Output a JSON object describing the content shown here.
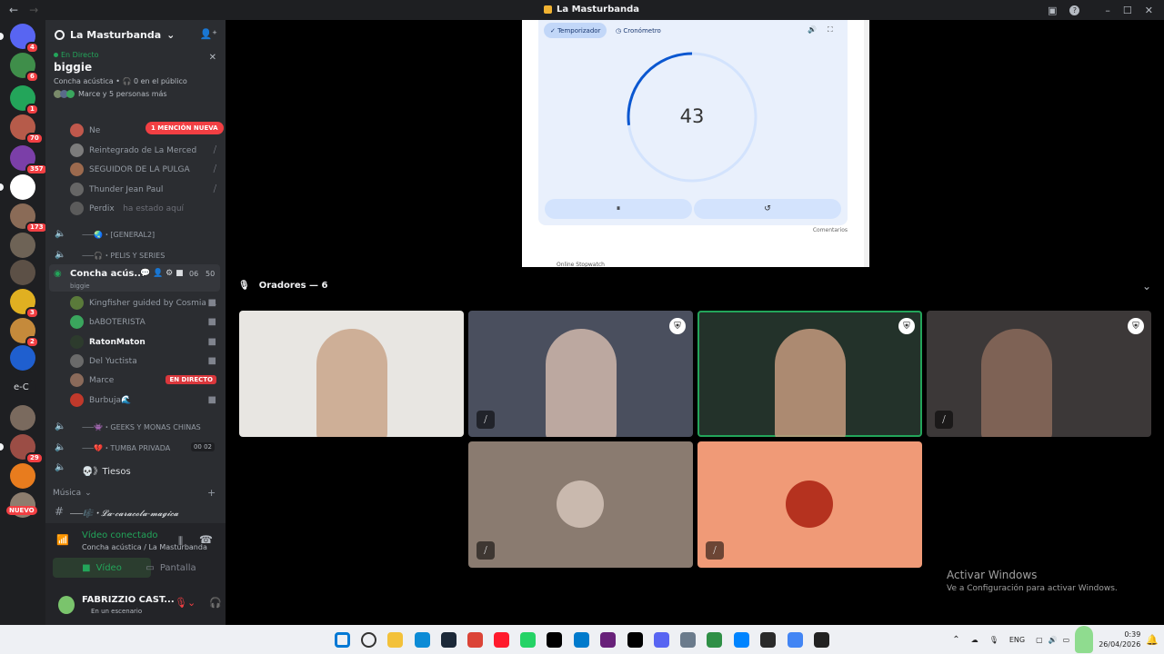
{
  "window": {
    "title": "La Masturbanda"
  },
  "guilds": [
    {
      "badge": "4",
      "color": "#5865f2"
    },
    {
      "badge": "6",
      "color": "#3f8e4a"
    },
    {
      "badge": "1",
      "color": "#23a55a"
    },
    {
      "badge": "70",
      "color": "#b65b4a"
    },
    {
      "badge": "357",
      "color": "#7b3fa8"
    },
    {
      "badge": "",
      "color": "#ffffff"
    },
    {
      "badge": "173",
      "color": "#8a6b57"
    },
    {
      "badge": "",
      "color": "#6e6356"
    },
    {
      "badge": "",
      "color": "#5c5046"
    },
    {
      "badge": "3",
      "color": "#e0b021"
    },
    {
      "badge": "2",
      "color": "#c58a3b"
    },
    {
      "badge": "",
      "color": "#1f5fcf"
    },
    {
      "badge": "",
      "color": "#1e1f22"
    },
    {
      "badge": "",
      "color": "#7a6a5e"
    },
    {
      "badge": "29",
      "color": "#9b4d45"
    },
    {
      "badge": "",
      "color": "#e87c1e"
    },
    {
      "badge": "",
      "color": "#8d7d6e"
    }
  ],
  "guild_text_item": "e-C",
  "guild_new_label": "NUEVO",
  "server": {
    "name": "La Masturbanda"
  },
  "stage": {
    "live_label": "En Directo",
    "name": "biggie",
    "sub": "Concha acústica • 🎧 0 en el público",
    "people": "Marce y 5 personas más"
  },
  "mention_label": "1 MENCIÓN NUEVA",
  "members_top": [
    {
      "name": "Ne",
      "color": "#c0584c"
    },
    {
      "name": "Reintegrado de La Merced",
      "color": "#7c7c7c"
    },
    {
      "name": "SEGUIDOR DE LA PULGA",
      "color": "#9c6a4e"
    },
    {
      "name": "Thunder Jean Paul",
      "color": "#666666"
    },
    {
      "name": "Perdix",
      "extra": "ha estado aquí",
      "color": "#5b5b5b"
    }
  ],
  "voice_channels_top": [
    {
      "name": "⸺🌏・[GENERAL2]"
    },
    {
      "name": "⸺🎧・PELIS Y SERIES"
    }
  ],
  "active_channel": {
    "name": "Concha acús...",
    "count_a": "06",
    "count_b": "50",
    "sub": "biggie"
  },
  "channel_members": [
    {
      "name": "Kingfisher guided by Cosmia ...",
      "color": "#5a7a3a",
      "live": false
    },
    {
      "name": "bABOTERISTA",
      "color": "#3aa55d",
      "live": false
    },
    {
      "name": "RatonMaton",
      "color": "#2d3b2d",
      "live": false
    },
    {
      "name": "Del Yuctista",
      "color": "#6a6a6a",
      "live": false
    },
    {
      "name": "Marce",
      "color": "#8a6a5a",
      "live": true
    },
    {
      "name": "Burbuja🌊",
      "color": "#c0392b",
      "live": false
    }
  ],
  "live_badge": "EN DIRECTO",
  "voice_channels_bottom": [
    {
      "name": "⸺👾・GEEKS Y MONAS CHINAS",
      "counts": ""
    },
    {
      "name": "⸺💔・TUMBA PRIVADA",
      "counts": "00 02"
    },
    {
      "name": "💀》Tiesos",
      "counts": ""
    }
  ],
  "category": {
    "name": "Música"
  },
  "text_channel": {
    "name": "⸺🎼・𝓛𝓪-𝓬𝓪𝓻𝓪𝓬𝓸𝓵𝓪-𝓶𝓪𝓰𝓲𝓬𝓪"
  },
  "voice_panel": {
    "status": "Vídeo conectado",
    "location": "Concha acústica / La Masturbanda",
    "video_label": "Vídeo",
    "screen_label": "Pantalla"
  },
  "user": {
    "name": "FABRIZZIO CAST...",
    "status": "En un escenario"
  },
  "timer": {
    "tab_timer": "Temporizador",
    "tab_stopwatch": "Cronómetro",
    "value": "43",
    "progress": 0.27,
    "pause_icon": "⏸",
    "reset_icon": "↺",
    "feedback": "Comentarios",
    "cutoff": "Online Stopwatch"
  },
  "speakers_header": "Oradores — 6",
  "tiles": [
    {
      "kind": "video",
      "bg": "#e8e6e2",
      "shield": false,
      "muted": false,
      "active": false
    },
    {
      "kind": "video",
      "bg": "#4a4f5e",
      "shield": true,
      "muted": true,
      "active": false
    },
    {
      "kind": "video",
      "bg": "#23322a",
      "shield": true,
      "muted": false,
      "active": true
    },
    {
      "kind": "video",
      "bg": "#3c3838",
      "shield": true,
      "muted": true,
      "active": false
    },
    {
      "kind": "avatar",
      "bg": "#8a7b70",
      "avatar": "#c9b9ae",
      "shield": false,
      "muted": true,
      "active": false
    },
    {
      "kind": "avatar",
      "bg": "#f09a77",
      "avatar": "#b5321f",
      "shield": false,
      "muted": true,
      "active": false
    }
  ],
  "watermark": {
    "title": "Activar Windows",
    "sub": "Ve a Configuración para activar Windows."
  },
  "taskbar": {
    "lang": "ENG",
    "time": "0:39",
    "date": "26/04/2026",
    "icons": [
      "windows-icon",
      "search-icon",
      "folder-icon",
      "edge-icon",
      "steam-icon",
      "chrome-icon",
      "opera-icon",
      "whatsapp-icon",
      "intellij-icon",
      "vscode-icon",
      "visualstudio-icon",
      "tiktok-icon",
      "discord-icon",
      "settings-icon",
      "notepad-icon",
      "messenger-icon",
      "terminal-icon",
      "chrome-icon-2",
      "app-icon"
    ],
    "colors": [
      "#0078d4",
      "#333333",
      "#f3c13a",
      "#0c8bd6",
      "#1b2838",
      "#db4437",
      "#ff1b2d",
      "#25d366",
      "#000000",
      "#007acc",
      "#68217a",
      "#000000",
      "#5865f2",
      "#6b7b8c",
      "#2f8f46",
      "#0084ff",
      "#2b2b2b",
      "#4285f4",
      "#222222"
    ]
  }
}
